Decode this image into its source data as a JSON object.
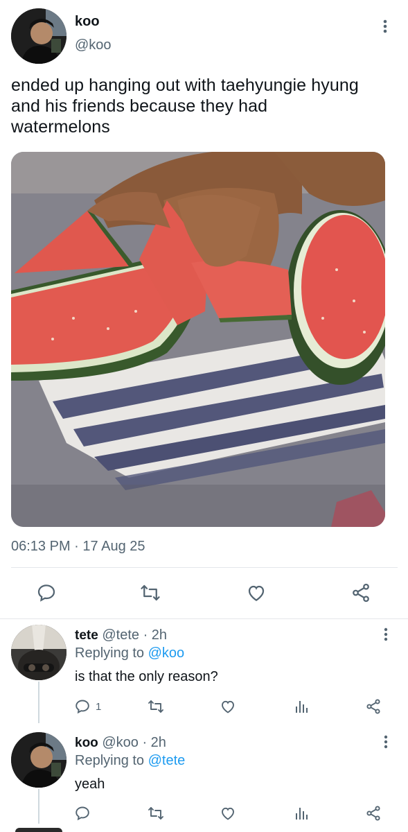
{
  "tweet": {
    "author_name": "koo",
    "author_handle": "@koo",
    "text_line1": "ended up hanging out with taehyungie hyung",
    "text_line2": "and his friends because they had",
    "text_line3": "watermelons",
    "time": "06:13 PM",
    "date": "17 Aug 25",
    "separator": "·"
  },
  "replies": [
    {
      "name": "tete",
      "handle": "@tete",
      "age": "· 2h",
      "replying_label": "Replying to",
      "replying_to": "@koo",
      "text": "is that the only reason?",
      "reply_count": "1"
    },
    {
      "name": "koo",
      "handle": "@koo",
      "age": "· 2h",
      "replying_label": "Replying to",
      "replying_to": "@tete",
      "text": "yeah"
    }
  ],
  "icons": {
    "more": "more-vertical-icon",
    "reply": "reply-icon",
    "retweet": "retweet-icon",
    "like": "heart-icon",
    "share": "share-icon",
    "views": "analytics-icon"
  },
  "colors": {
    "link": "#1d9bf0",
    "muted": "#536471",
    "divider": "#e4e7ea"
  }
}
